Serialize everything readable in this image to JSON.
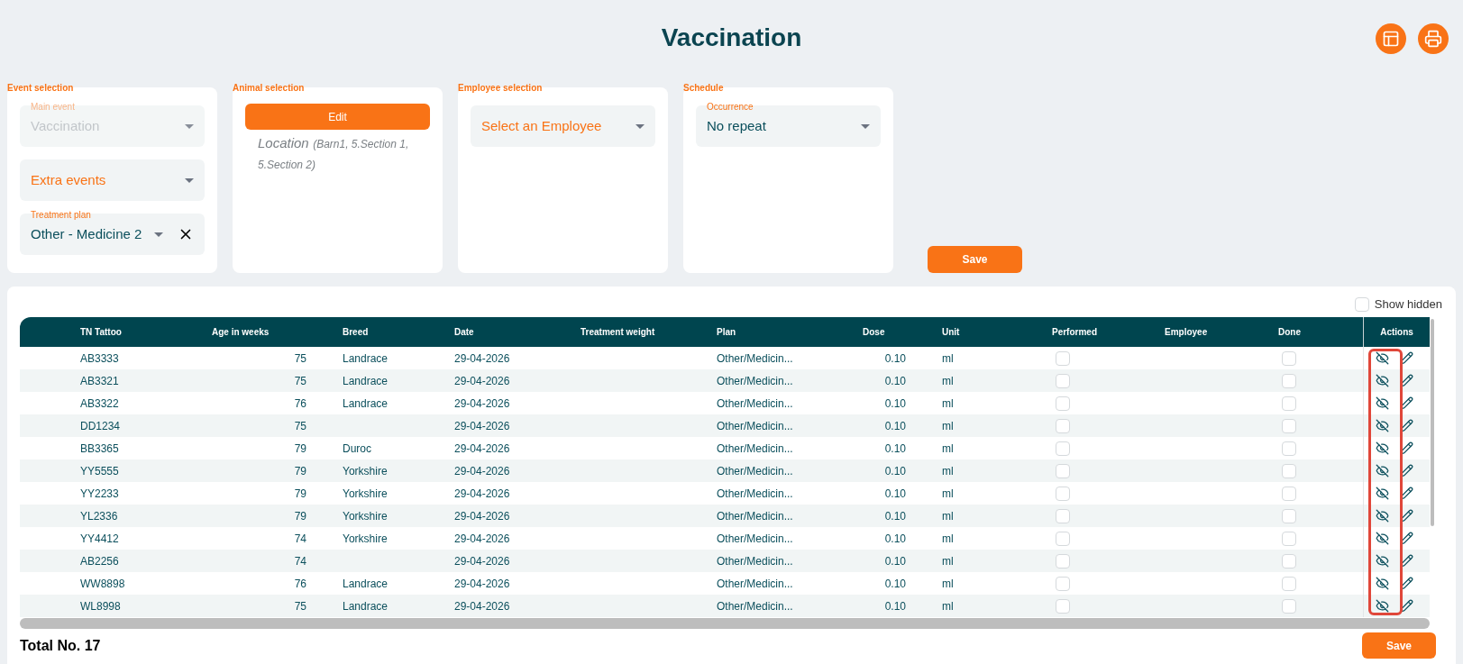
{
  "title": "Vaccination",
  "toolbar": [
    {
      "kind": "layout"
    },
    {
      "kind": "print"
    }
  ],
  "sections": [
    {
      "title": "Event selection",
      "fields": [
        {
          "label": "Main event",
          "value": "Vaccination",
          "disabled": true
        },
        {
          "placeholder": "Extra events",
          "disabled": false
        },
        {
          "label": "Treatment plan",
          "value": "Other - Medicine 2",
          "disabled": false,
          "clearable": true
        }
      ]
    },
    {
      "title": "Animal selection",
      "button": "Edit",
      "note": {
        "label": "Location",
        "detail": "(Barn1, 5.Section 1, 5.Section 2)"
      }
    },
    {
      "title": "Employee selection",
      "fields": [
        {
          "placeholder": "Select an Employee",
          "disabled": false
        }
      ]
    },
    {
      "title": "Schedule",
      "fields": [
        {
          "label": "Occurrence",
          "value": "No repeat",
          "disabled": false
        }
      ]
    }
  ],
  "top_save": "Save",
  "show_hidden": {
    "label": "Show hidden",
    "checked": false
  },
  "table": {
    "actions_highlighted": true,
    "columns": [
      {
        "label": "TN Tattoo",
        "kind": "text"
      },
      {
        "label": "Age in weeks",
        "kind": "number"
      },
      {
        "label": "Breed",
        "kind": "text"
      },
      {
        "label": "Date",
        "kind": "text"
      },
      {
        "label": "Treatment weight",
        "kind": "text"
      },
      {
        "label": "Plan",
        "kind": "text"
      },
      {
        "label": "Dose",
        "kind": "number"
      },
      {
        "label": "Unit",
        "kind": "text"
      },
      {
        "label": "Performed",
        "kind": "check"
      },
      {
        "label": "Employee",
        "kind": "text"
      },
      {
        "label": "Done",
        "kind": "check"
      },
      {
        "label": "Actions",
        "kind": "actions"
      }
    ],
    "rows": [
      {
        "cells": [
          "AB3333",
          "75",
          "Landrace",
          "29-04-2026",
          null,
          "Other/Medicin...",
          "0.10",
          "ml",
          null
        ],
        "checks": [
          false,
          false
        ]
      },
      {
        "cells": [
          "AB3321",
          "75",
          "Landrace",
          "29-04-2026",
          null,
          "Other/Medicin...",
          "0.10",
          "ml",
          null
        ],
        "checks": [
          false,
          false
        ]
      },
      {
        "cells": [
          "AB3322",
          "76",
          "Landrace",
          "29-04-2026",
          null,
          "Other/Medicin...",
          "0.10",
          "ml",
          null
        ],
        "checks": [
          false,
          false
        ]
      },
      {
        "cells": [
          "DD1234",
          "75",
          null,
          "29-04-2026",
          null,
          "Other/Medicin...",
          "0.10",
          "ml",
          null
        ],
        "checks": [
          false,
          false
        ]
      },
      {
        "cells": [
          "BB3365",
          "79",
          "Duroc",
          "29-04-2026",
          null,
          "Other/Medicin...",
          "0.10",
          "ml",
          null
        ],
        "checks": [
          false,
          false
        ]
      },
      {
        "cells": [
          "YY5555",
          "79",
          "Yorkshire",
          "29-04-2026",
          null,
          "Other/Medicin...",
          "0.10",
          "ml",
          null
        ],
        "checks": [
          false,
          false
        ]
      },
      {
        "cells": [
          "YY2233",
          "79",
          "Yorkshire",
          "29-04-2026",
          null,
          "Other/Medicin...",
          "0.10",
          "ml",
          null
        ],
        "checks": [
          false,
          false
        ]
      },
      {
        "cells": [
          "YL2336",
          "79",
          "Yorkshire",
          "29-04-2026",
          null,
          "Other/Medicin...",
          "0.10",
          "ml",
          null
        ],
        "checks": [
          false,
          false
        ]
      },
      {
        "cells": [
          "YY4412",
          "74",
          "Yorkshire",
          "29-04-2026",
          null,
          "Other/Medicin...",
          "0.10",
          "ml",
          null
        ],
        "checks": [
          false,
          false
        ]
      },
      {
        "cells": [
          "AB2256",
          "74",
          null,
          "29-04-2026",
          null,
          "Other/Medicin...",
          "0.10",
          "ml",
          null
        ],
        "checks": [
          false,
          false
        ]
      },
      {
        "cells": [
          "WW8898",
          "76",
          "Landrace",
          "29-04-2026",
          null,
          "Other/Medicin...",
          "0.10",
          "ml",
          null
        ],
        "checks": [
          false,
          false
        ]
      },
      {
        "cells": [
          "WL8998",
          "75",
          "Landrace",
          "29-04-2026",
          null,
          "Other/Medicin...",
          "0.10",
          "ml",
          null
        ],
        "checks": [
          false,
          false
        ]
      }
    ]
  },
  "total": "Total No. 17",
  "bottom_save": "Save"
}
